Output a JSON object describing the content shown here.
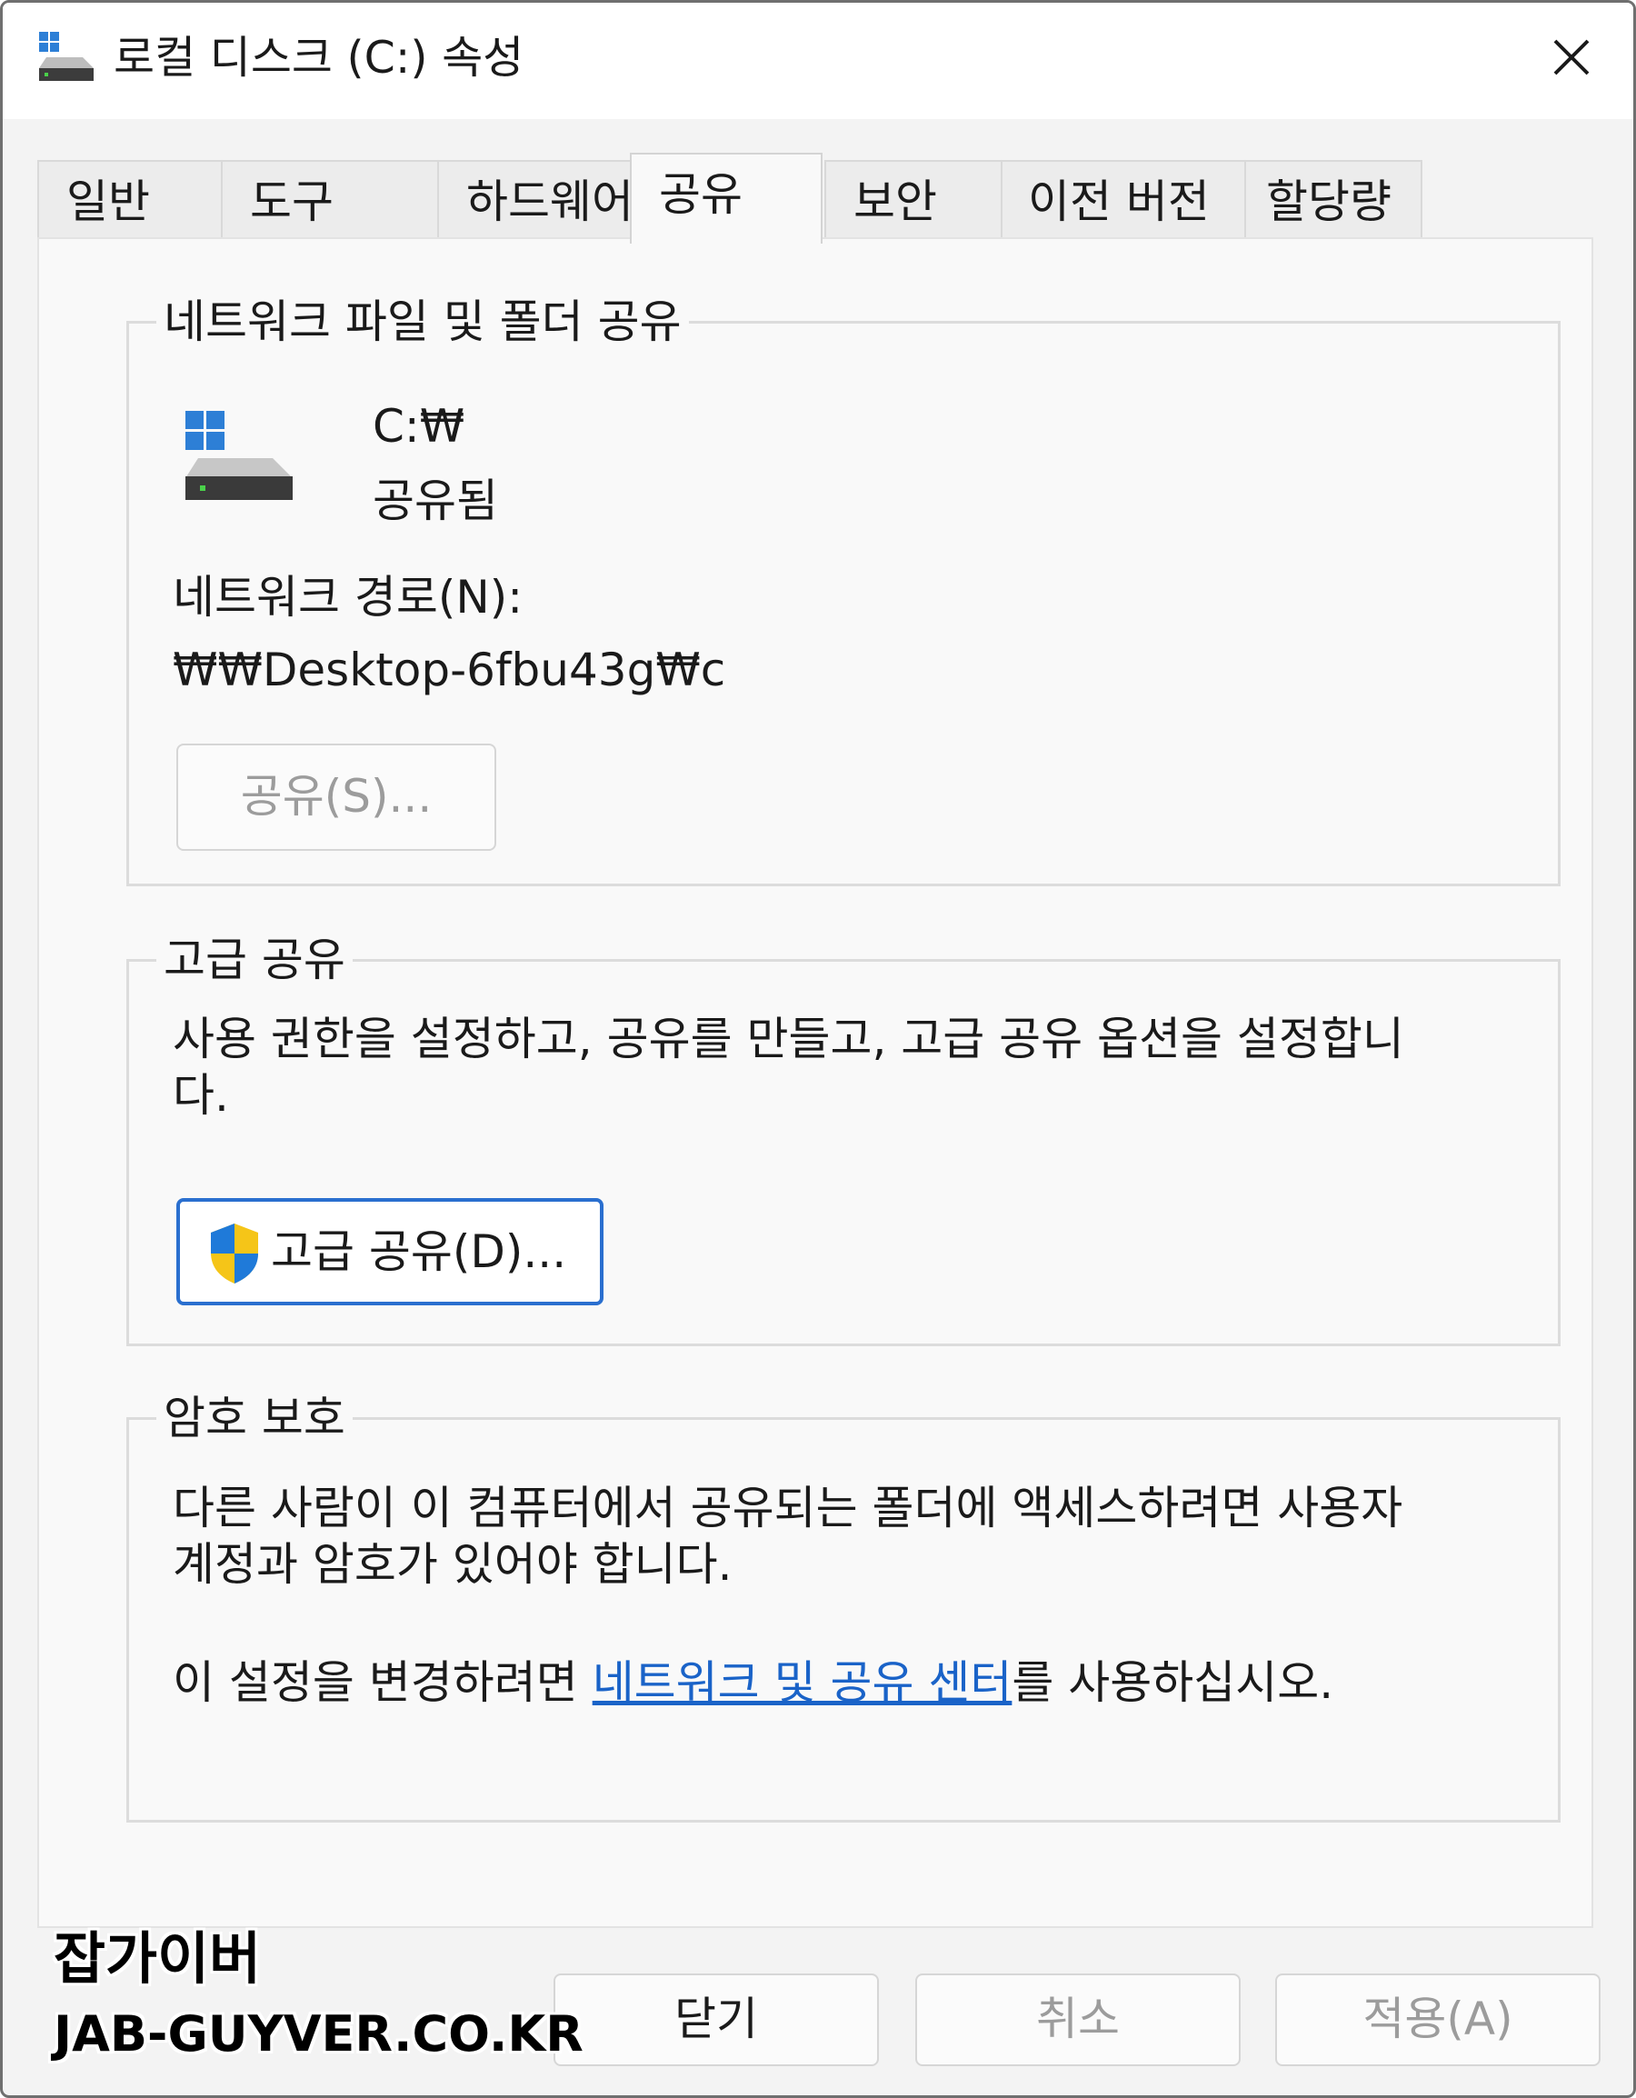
{
  "window": {
    "title": "로컬 디스크 (C:) 속성",
    "close_icon": "close-icon"
  },
  "tabs": [
    {
      "label": "일반"
    },
    {
      "label": "도구"
    },
    {
      "label": "하드웨어"
    },
    {
      "label": "공유",
      "active": true
    },
    {
      "label": "보안"
    },
    {
      "label": "이전 버전"
    },
    {
      "label": "할당량"
    }
  ],
  "network_sharing": {
    "legend": "네트워크 파일 및 폴더 공유",
    "drive_name": "C:₩",
    "status": "공유됨",
    "path_label": "네트워크 경로(N):",
    "path_value": "₩₩Desktop-6fbu43g₩c",
    "share_button": "공유(S)..."
  },
  "advanced_sharing": {
    "legend": "고급 공유",
    "description_line1": "사용 권한을 설정하고, 공유를 만들고, 고급 공유 옵션을 설정합니",
    "description_line2": "다.",
    "button": "고급 공유(D)..."
  },
  "password_protection": {
    "legend": "암호 보호",
    "description_line1": "다른 사람이 이 컴퓨터에서 공유되는 폴더에 액세스하려면 사용자",
    "description_line2": "계정과 암호가 있어야 합니다.",
    "change_prefix": "이 설정을 변경하려면 ",
    "link_text": "네트워크 및 공유 센터",
    "change_suffix": "를 사용하십시오."
  },
  "footer": {
    "close": "닫기",
    "cancel": "취소",
    "apply": "적용(A)"
  },
  "watermark": {
    "name": "잡가이버",
    "site": "JAB-GUYVER.CO.KR"
  },
  "colors": {
    "accent": "#2a6fcf",
    "link": "#1a63c8",
    "shield_blue": "#1f7ad9",
    "shield_yellow": "#f5c518"
  }
}
